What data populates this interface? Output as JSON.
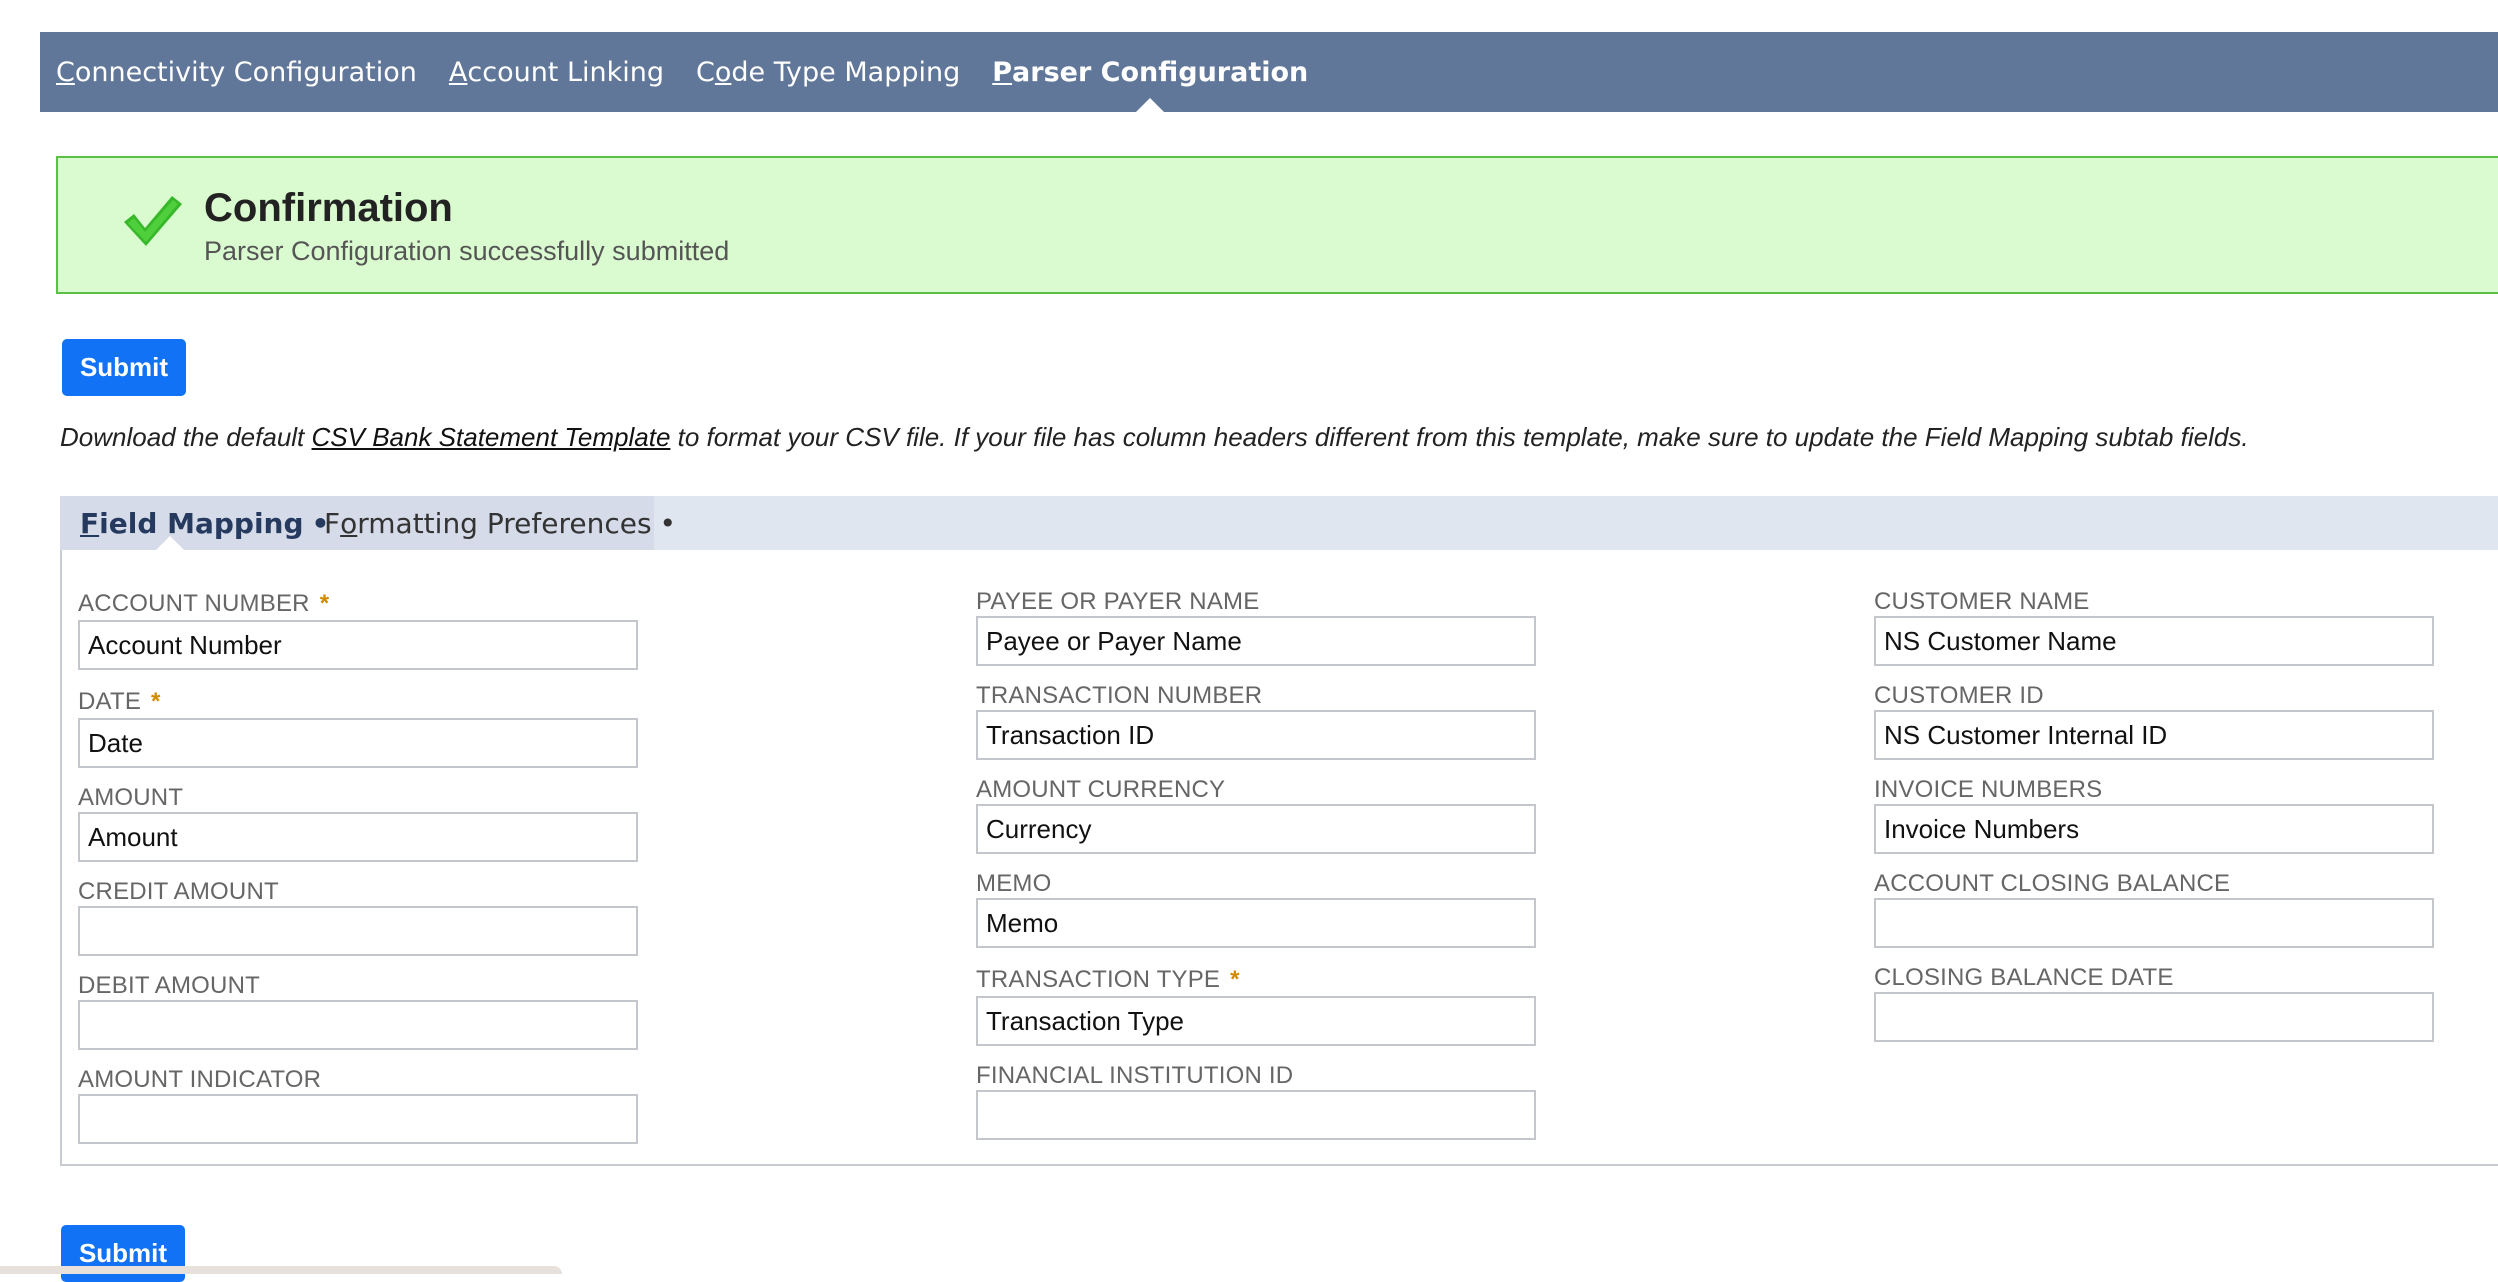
{
  "topnav": {
    "tabs": [
      {
        "first": "C",
        "rest": "onnectivity Configuration",
        "active": false
      },
      {
        "first": "A",
        "rest": "ccount Linking",
        "active": false
      },
      {
        "pre": "C",
        "first": "o",
        "rest": "de Type Mapping",
        "active": false
      },
      {
        "first": "P",
        "rest": "arser Configuration",
        "active": true
      }
    ],
    "bg_color": "#607799"
  },
  "confirmation": {
    "title": "Confirmation",
    "message": "Parser Configuration successfully submitted",
    "icon": "check-icon",
    "bg_color": "#dafad0",
    "border_color": "#5bc146"
  },
  "buttons": {
    "submit_label": "Submit",
    "color": "#1172f5"
  },
  "info": {
    "before": "Download the default ",
    "link": "CSV Bank Statement Template",
    "after": " to format your CSV file. If your file has column headers different from this template, make sure to update the Field Mapping subtab fields."
  },
  "subtabs": [
    {
      "first": "F",
      "rest": "ield Mapping",
      "dot": "•",
      "active": true
    },
    {
      "pre": "F",
      "first": "o",
      "rest": "rmatting Preferences",
      "dot": "•",
      "active": false
    }
  ],
  "required_mark": "*",
  "fields": {
    "account_number": {
      "label": "ACCOUNT NUMBER",
      "value": "Account Number",
      "required": true
    },
    "date": {
      "label": "DATE",
      "value": "Date",
      "required": true
    },
    "amount": {
      "label": "AMOUNT",
      "value": "Amount",
      "required": false
    },
    "credit_amount": {
      "label": "CREDIT AMOUNT",
      "value": "",
      "required": false
    },
    "debit_amount": {
      "label": "DEBIT AMOUNT",
      "value": "",
      "required": false
    },
    "amount_indicator": {
      "label": "AMOUNT INDICATOR",
      "value": "",
      "required": false
    },
    "payee_or_payer_name": {
      "label": "PAYEE OR PAYER NAME",
      "value": "Payee or Payer Name",
      "required": false
    },
    "transaction_number": {
      "label": "TRANSACTION NUMBER",
      "value": "Transaction ID",
      "required": false
    },
    "amount_currency": {
      "label": "AMOUNT CURRENCY",
      "value": "Currency",
      "required": false
    },
    "memo": {
      "label": "MEMO",
      "value": "Memo",
      "required": false
    },
    "transaction_type": {
      "label": "TRANSACTION TYPE",
      "value": "Transaction Type",
      "required": true
    },
    "financial_institution_id": {
      "label": "FINANCIAL INSTITUTION ID",
      "value": "",
      "required": false
    },
    "customer_name": {
      "label": "CUSTOMER NAME",
      "value": "NS Customer Name",
      "required": false
    },
    "customer_id": {
      "label": "CUSTOMER ID",
      "value": "NS Customer Internal ID",
      "required": false
    },
    "invoice_numbers": {
      "label": "INVOICE NUMBERS",
      "value": "Invoice Numbers",
      "required": false
    },
    "account_closing_balance": {
      "label": "ACCOUNT CLOSING BALANCE",
      "value": "",
      "required": false
    },
    "closing_balance_date": {
      "label": "CLOSING BALANCE DATE",
      "value": "",
      "required": false
    }
  }
}
